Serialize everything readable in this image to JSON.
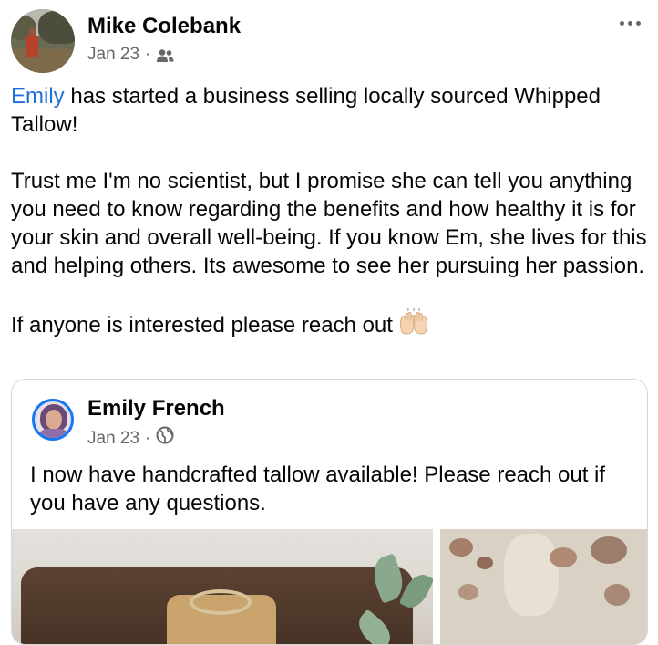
{
  "post": {
    "author": "Mike Colebank",
    "date": "Jan 23",
    "separator": "·",
    "audience_icon": "friends-icon",
    "more_icon": "more-horizontal-icon",
    "body": {
      "mention": "Emily",
      "line1_rest": " has started a business selling locally sourced Whipped Tallow!",
      "paragraph2": "Trust me I'm no scientist, but I promise she can tell you anything you need to know regarding the benefits and how healthy it is for your skin and overall well-being. If you know Em, she lives for this and helping others. Its awesome to see her pursuing her passion.",
      "paragraph3": "If anyone is interested please reach out",
      "emoji": "raising-hands-emoji"
    }
  },
  "shared_post": {
    "author": "Emily French",
    "date": "Jan 23",
    "separator": "·",
    "audience_icon": "globe-icon",
    "text": "I now have handcrafted tallow available! Please reach out if you have any questions."
  },
  "colors": {
    "mention": "#216fdb",
    "secondary_text": "#65676b",
    "avatar_ring": "#1877f2"
  }
}
